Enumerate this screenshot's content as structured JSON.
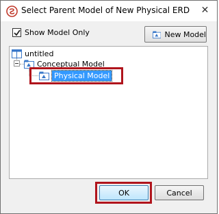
{
  "window": {
    "title": "Select Parent Model of New Physical ERD",
    "close_glyph": "✕"
  },
  "options": {
    "show_model_only_label": "Show Model Only",
    "show_model_only_checked": true
  },
  "toolbar": {
    "new_model_label": "New Model"
  },
  "tree": {
    "root": {
      "label": "untitled",
      "icon": "project-icon"
    },
    "children": [
      {
        "label": "Conceptual Model",
        "icon": "model-icon",
        "expanded": true,
        "children": [
          {
            "label": "Physical Model",
            "icon": "model-icon",
            "selected": true
          }
        ]
      }
    ]
  },
  "footer": {
    "ok_label": "OK",
    "cancel_label": "Cancel"
  },
  "colors": {
    "highlight": "#b0141c",
    "selection": "#3399ff",
    "model_icon": "#3a78c9"
  }
}
